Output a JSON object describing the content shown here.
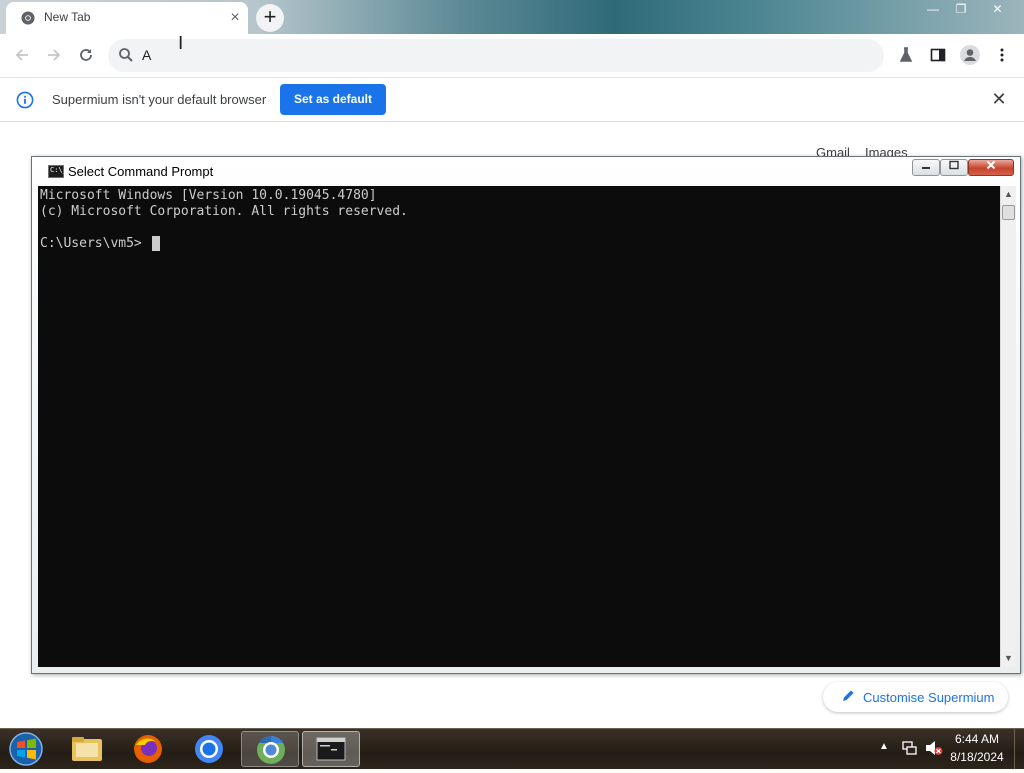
{
  "browser": {
    "tab": {
      "title": "New Tab",
      "close_glyph": "×"
    },
    "newtab_glyph": "+",
    "window_controls": {
      "minimize": "—",
      "maximize": "❐",
      "close": "✕"
    },
    "omnibox": {
      "text": "A",
      "icon": "search-icon"
    },
    "infobar": {
      "message": "Supermium isn't your default browser",
      "button_label": "Set as default",
      "close_glyph": "✕"
    },
    "ntp": {
      "links": [
        "Gmail",
        "Images"
      ],
      "customise_label": "Customise Supermium"
    },
    "accent_color": "#1a73e8"
  },
  "cmd": {
    "title": "Select Command Prompt",
    "icon_text": "C:\\_",
    "lines": [
      "Microsoft Windows [Version 10.0.19045.4780]",
      "(c) Microsoft Corporation. All rights reserved.",
      "C:\\Users\\vm5>"
    ]
  },
  "taskbar": {
    "apps": [
      "start-orb",
      "file-explorer",
      "firefox",
      "chrome",
      "chromium",
      "command-prompt"
    ],
    "tray": {
      "arrow": "▲",
      "time": "6:44 AM",
      "date": "8/18/2024"
    }
  }
}
